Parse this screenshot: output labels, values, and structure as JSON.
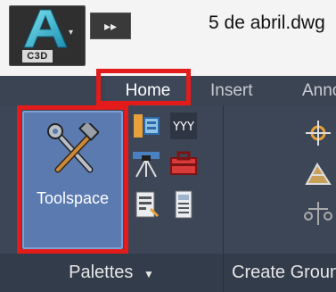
{
  "app": {
    "logo_letter": "A",
    "logo_label": "C3D",
    "document_title": "5 de abril.dwg",
    "qat_glyph": "▸▸"
  },
  "tabs": [
    {
      "label": "Home",
      "active": true
    },
    {
      "label": "Insert",
      "active": false
    },
    {
      "label": "Annotate",
      "active": false
    }
  ],
  "panels": {
    "palettes": {
      "label": "Palettes",
      "dropdown_glyph": "▼",
      "big_button_label": "Toolspace",
      "big_button_icon": "tools-icon",
      "small_icons": [
        "prospector-icon",
        "data-shortcut-icon",
        "survey-icon",
        "toolbox-icon",
        "properties-icon",
        "panorama-icon"
      ]
    },
    "create_ground_data": {
      "label": "Create Ground Data"
    }
  },
  "colors": {
    "highlight": "#e31b1b",
    "ribbon": "#3d4656",
    "active_button": "#5a7ab0"
  }
}
